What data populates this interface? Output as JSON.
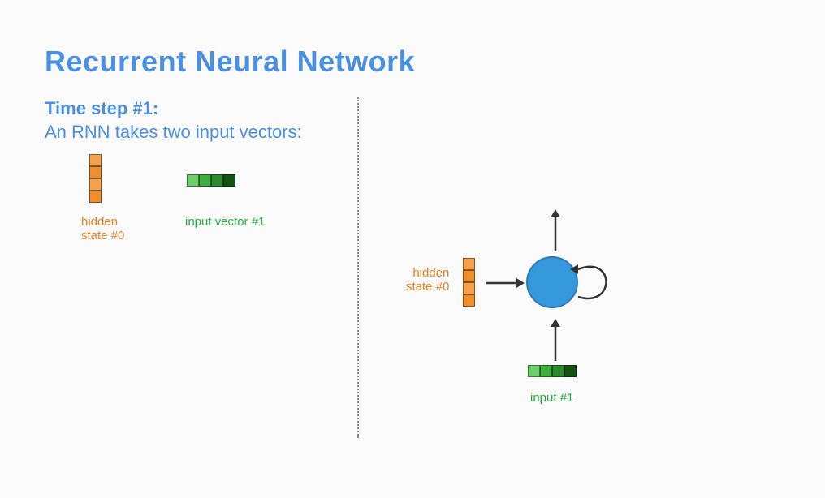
{
  "title": "Recurrent Neural Network",
  "timestep_label": "Time step #1:",
  "subtext": "An RNN takes two input vectors:",
  "left": {
    "hidden_label_line1": "hidden",
    "hidden_label_line2": "state #0",
    "input_label": "input vector #1"
  },
  "right": {
    "hidden_label_line1": "hidden",
    "hidden_label_line2": "state #0",
    "input_label": "input #1"
  },
  "colors": {
    "accent_blue": "#4a90e2",
    "node_blue": "#3498db",
    "orange": "#f18e2c",
    "green": "#27ae43"
  }
}
